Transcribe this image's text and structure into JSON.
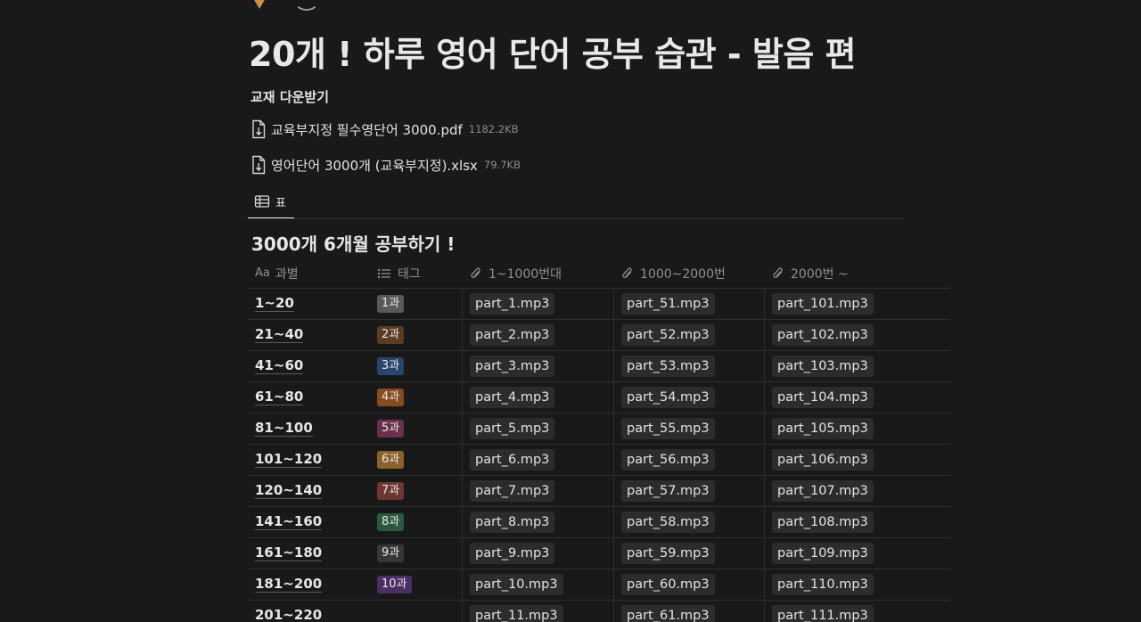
{
  "page": {
    "title": "20개 ! 하루 영어 단어 공부 습관 - 발음 편",
    "icons": {
      "emoji": "page-emoji-icon",
      "cover": "page-avatar-icon"
    }
  },
  "downloads": {
    "heading": "교재 다운받기",
    "files": [
      {
        "name": "교육부지정 필수영단어 3000.pdf",
        "size": "1182.2KB",
        "icon": "file-download-icon"
      },
      {
        "name": "영어단어 3000개 (교육부지정).xlsx",
        "size": "79.7KB",
        "icon": "file-download-icon"
      }
    ]
  },
  "view": {
    "tab_label": "표",
    "tab_icon": "table-icon"
  },
  "database": {
    "title": "3000개 6개월 공부하기 !",
    "columns": [
      {
        "label": "과별",
        "prefix": "Aa",
        "icon": "text-property-icon"
      },
      {
        "label": "태그",
        "icon": "list-icon"
      },
      {
        "label": "1~1000번대",
        "icon": "paperclip-icon"
      },
      {
        "label": "1000~2000번",
        "icon": "paperclip-icon"
      },
      {
        "label": "2000번 ~",
        "icon": "paperclip-icon"
      }
    ],
    "rows": [
      {
        "range": "1~20",
        "tag": "1과",
        "tag_color": "#5a5a5a",
        "f1": "part_1.mp3",
        "f2": "part_51.mp3",
        "f3": "part_101.mp3"
      },
      {
        "range": "21~40",
        "tag": "2과",
        "tag_color": "#5c3b23",
        "f1": "part_2.mp3",
        "f2": "part_52.mp3",
        "f3": "part_102.mp3"
      },
      {
        "range": "41~60",
        "tag": "3과",
        "tag_color": "#28456c",
        "f1": "part_3.mp3",
        "f2": "part_53.mp3",
        "f3": "part_103.mp3"
      },
      {
        "range": "61~80",
        "tag": "4과",
        "tag_color": "#854c1d",
        "f1": "part_4.mp3",
        "f2": "part_54.mp3",
        "f3": "part_104.mp3"
      },
      {
        "range": "81~100",
        "tag": "5과",
        "tag_color": "#69314c",
        "f1": "part_5.mp3",
        "f2": "part_55.mp3",
        "f3": "part_105.mp3"
      },
      {
        "range": "101~120",
        "tag": "6과",
        "tag_color": "#89632a",
        "f1": "part_6.mp3",
        "f2": "part_56.mp3",
        "f3": "part_106.mp3"
      },
      {
        "range": "120~140",
        "tag": "7과",
        "tag_color": "#6e3630",
        "f1": "part_7.mp3",
        "f2": "part_57.mp3",
        "f3": "part_107.mp3"
      },
      {
        "range": "141~160",
        "tag": "8과",
        "tag_color": "#2b593f",
        "f1": "part_8.mp3",
        "f2": "part_58.mp3",
        "f3": "part_108.mp3"
      },
      {
        "range": "161~180",
        "tag": "9과",
        "tag_color": "#373737",
        "f1": "part_9.mp3",
        "f2": "part_59.mp3",
        "f3": "part_109.mp3"
      },
      {
        "range": "181~200",
        "tag": "10과",
        "tag_color": "#492f64",
        "f1": "part_10.mp3",
        "f2": "part_60.mp3",
        "f3": "part_110.mp3"
      },
      {
        "range": "201~220",
        "tag": "",
        "tag_color": "",
        "f1": "part_11.mp3",
        "f2": "part_61.mp3",
        "f3": "part_111.mp3"
      }
    ]
  }
}
